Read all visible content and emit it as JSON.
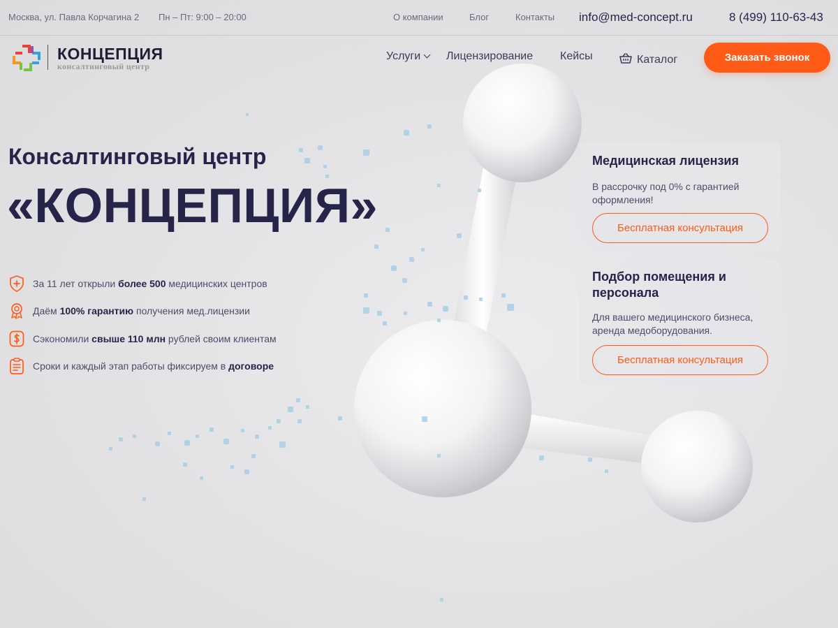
{
  "topbar": {
    "address": "Москва, ул. Павла Корчагина 2",
    "hours": "Пн – Пт: 9:00 – 20:00",
    "links": [
      "О компании",
      "Блог",
      "Контакты"
    ],
    "email": "info@med-concept.ru",
    "phone": "8 (499) 110-63-43"
  },
  "logo": {
    "name": "КОНЦЕПЦИЯ",
    "tagline": "консалтинговый центр"
  },
  "nav": {
    "services": "Услуги",
    "licensing": "Лицензирование",
    "cases": "Кейсы",
    "catalog": "Каталог"
  },
  "cta": {
    "call": "Заказать звонок"
  },
  "hero": {
    "subtitle": "Консалтинговый центр",
    "title": "«КОНЦЕПЦИЯ»"
  },
  "features": [
    {
      "icon": "shield-plus-icon",
      "pre": "За 11 лет открыли ",
      "bold": "более 500",
      "post": " медицинских центров"
    },
    {
      "icon": "award-icon",
      "pre": "Даём ",
      "bold": "100% гарантию",
      "post": " получения мед.лицензии"
    },
    {
      "icon": "dollar-icon",
      "pre": "Сэкономили ",
      "bold": "свыше 110 млн",
      "post": " рублей своим клиентам"
    },
    {
      "icon": "contract-icon",
      "pre": "Сроки и каждый этап работы фиксируем в ",
      "bold": "договоре",
      "post": ""
    }
  ],
  "cards": [
    {
      "title": "Медицинская лицензия",
      "text": "В рассрочку под 0% с гарантией оформления!",
      "button": "Бесплатная консультация"
    },
    {
      "title": "Подбор помещения и персонала",
      "text": "Для вашего медицинского бизнеса, аренда медоборудования.",
      "button": "Бесплатная консультация"
    }
  ],
  "colors": {
    "accent": "#ff5a16",
    "text_dark": "#27244a",
    "background": "#e3e3e5"
  }
}
